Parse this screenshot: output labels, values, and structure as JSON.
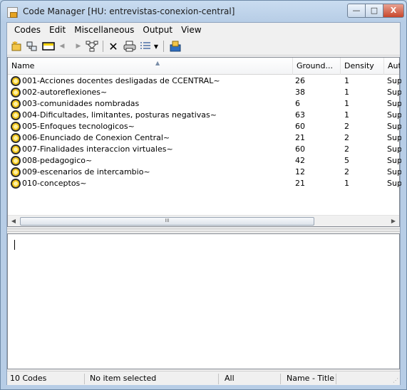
{
  "window": {
    "title": "Code Manager [HU: entrevistas-conexion-central]",
    "caption_min": "—",
    "caption_max": "□",
    "caption_close": "X"
  },
  "menu": [
    "Codes",
    "Edit",
    "Miscellaneous",
    "Output",
    "View"
  ],
  "toolbar": {
    "icons": [
      "new-code-icon",
      "link-icon",
      "color-icon",
      "nav-back-icon",
      "nav-forward-icon",
      "network-icon",
      "delete-icon",
      "print-icon",
      "list-view-icon",
      "dropdown-icon",
      "export-icon"
    ]
  },
  "list": {
    "columns": [
      "Name",
      "Ground...",
      "Density",
      "Auth"
    ],
    "rows": [
      {
        "name": "001-Acciones docentes desligadas de CCENTRAL~",
        "grounded": "26",
        "density": "1",
        "author": "Supe"
      },
      {
        "name": "002-autoreflexiones~",
        "grounded": "38",
        "density": "1",
        "author": "Supe"
      },
      {
        "name": "003-comunidades nombradas",
        "grounded": "6",
        "density": "1",
        "author": "Supe"
      },
      {
        "name": "004-Dificultades, limitantes, posturas negativas~",
        "grounded": "63",
        "density": "1",
        "author": "Supe"
      },
      {
        "name": "005-Enfoques tecnologicos~",
        "grounded": "60",
        "density": "2",
        "author": "Supe"
      },
      {
        "name": "006-Enunciado de Conexion Central~",
        "grounded": "21",
        "density": "2",
        "author": "Supe"
      },
      {
        "name": "007-Finalidades interaccion virtuales~",
        "grounded": "60",
        "density": "2",
        "author": "Supe"
      },
      {
        "name": "008-pedagogico~",
        "grounded": "42",
        "density": "5",
        "author": "Supe"
      },
      {
        "name": "009-escenarios de intercambio~",
        "grounded": "12",
        "density": "2",
        "author": "Supe"
      },
      {
        "name": "010-conceptos~",
        "grounded": "21",
        "density": "1",
        "author": "Supe"
      }
    ],
    "scroll_thumb": "III"
  },
  "status": {
    "count": "10 Codes",
    "selection": "No item selected",
    "filter": "All",
    "sort": "Name - Title"
  }
}
